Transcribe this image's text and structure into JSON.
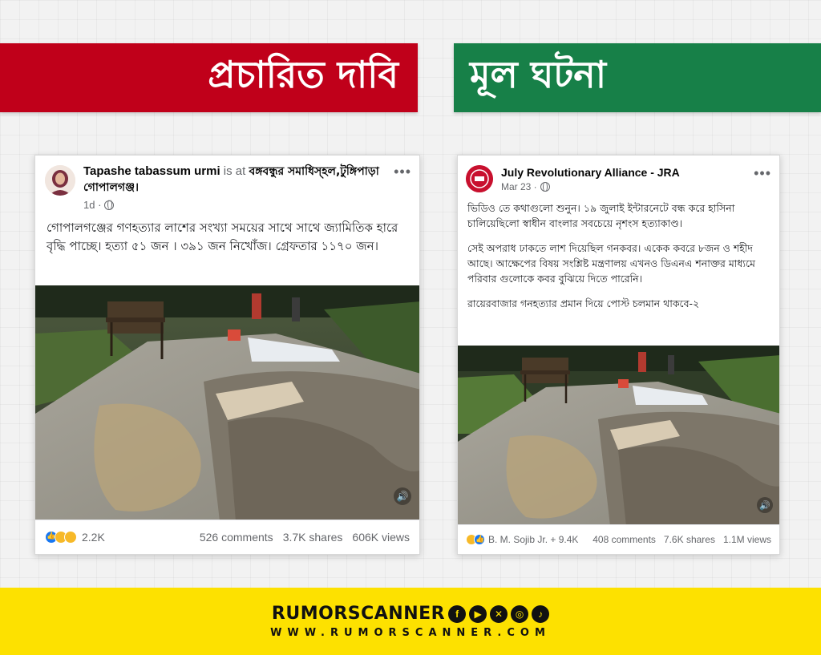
{
  "banners": {
    "claim": "প্রচারিত দাবি",
    "original": "মূল ঘটনা"
  },
  "left_post": {
    "author": "Tapashe tabassum urmi",
    "is_at": "is at",
    "location": "বঙ্গবন্ধুর সমাধিস্হল,টুঙ্গিপাড়া গোপালগঞ্জ।",
    "time": "1d ·",
    "text": "গোপালগঞ্জের গণহত্যার লাশের সংখ্যা সময়ের সাথে সাথে জ্যামিতিক হারে বৃদ্ধি পাচ্ছে। হত্যা ৫১ জন । ৩৯১ জন নিখোঁজ। গ্রেফতার ১১৭০ জন।",
    "reaction_count": "2.2K",
    "comments": "526 comments",
    "shares": "3.7K shares",
    "views": "606K views"
  },
  "right_post": {
    "author": "July Revolutionary Alliance - JRA",
    "time": "Mar 23 ·",
    "text_p1": "ভিডিও তে কথাগুলো শুনুন। ১৯ জুলাই ইন্টারনেটে বন্ধ করে হাসিনা চালিয়েছিলো স্বাধীন বাংলার সবচেয়ে নৃশংস হত্যাকাণ্ড।",
    "text_p2": "সেই অপরাধ ঢাকতে লাশ দিয়েছিল গনকবর। একেক কবরে ৮জন ও শহীদ আছে। আক্ষেপের বিষয় সংশ্লিষ্ট মন্ত্রণালয় এখনও ডিএনএ শনাক্তর মাধ্যমে পরিবার গুলোকে কবর বুঝিয়ে দিতে পারেনি।",
    "text_p3": "রায়েরবাজার গনহত্যার প্রমান দিয়ে পোস্ট চলমান থাকবে-২",
    "reactors": "B. M. Sojib Jr. + 9.4K",
    "comments": "408 comments",
    "shares": "7.6K shares",
    "views": "1.1M views"
  },
  "brand": {
    "name": "RUMORSCANNER",
    "url": "WWW.RUMORSCANNER.COM",
    "social_icons": [
      "facebook-icon",
      "youtube-icon",
      "x-icon",
      "instagram-icon",
      "tiktok-icon"
    ]
  },
  "colors": {
    "claim_banner": "#c0001a",
    "original_banner": "#178048",
    "footer_bar": "#fde100"
  }
}
